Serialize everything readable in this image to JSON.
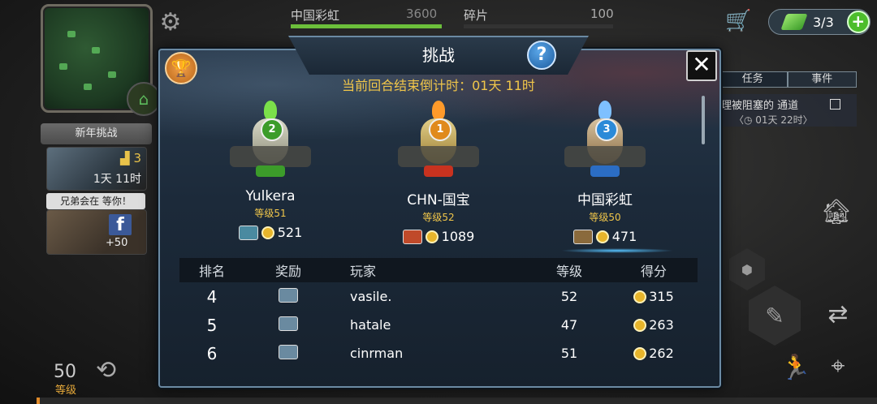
{
  "hud": {
    "clan_name": "中国彩虹",
    "clan_points": "3600",
    "fragments_label": "碎片",
    "fragments_value": "100",
    "energy": "3/3",
    "colors": {
      "accent_green": "#6cbf3b",
      "gold": "#f0c64a"
    }
  },
  "quests": {
    "tabs": [
      "任务",
      "事件"
    ],
    "item_text": "理被阻塞的 通道",
    "item_timer": "〈◷ 01天 22时〉"
  },
  "left_panel": {
    "new_year_label": "新年挑战",
    "new_year_rank": "3",
    "new_year_time": "1天 11时",
    "brothers_label": "兄弟会在 等你！",
    "facebook_icon": "f",
    "facebook_reward": "+50"
  },
  "player": {
    "level_number": "50",
    "level_label": "等级"
  },
  "dialog": {
    "title": "挑战",
    "help": "?",
    "close": "✕",
    "countdown": "当前回合结束倒计时：01天 11时",
    "podium": [
      {
        "place": "2",
        "name": "Yulkera",
        "level": "等级51",
        "score": "521",
        "cup_color": "#3c9c2a",
        "flame_color": "#7be04a"
      },
      {
        "place": "1",
        "name": "CHN-国宝",
        "level": "等级52",
        "score": "1089",
        "cup_color": "#c8321f",
        "flame_color": "#ff9a2a"
      },
      {
        "place": "3",
        "name": "中国彩虹",
        "level": "等级50",
        "score": "471",
        "cup_color": "#2b6dc4",
        "flame_color": "#7ec0ff"
      }
    ],
    "table": {
      "headers": {
        "rank": "排名",
        "reward": "奖励",
        "player": "玩家",
        "level": "等级",
        "score": "得分"
      },
      "rows": [
        {
          "rank": "4",
          "player": "vasile.",
          "level": "52",
          "score": "315"
        },
        {
          "rank": "5",
          "player": "hatale",
          "level": "47",
          "score": "263"
        },
        {
          "rank": "6",
          "player": "cinrman",
          "level": "51",
          "score": "262"
        }
      ]
    }
  }
}
